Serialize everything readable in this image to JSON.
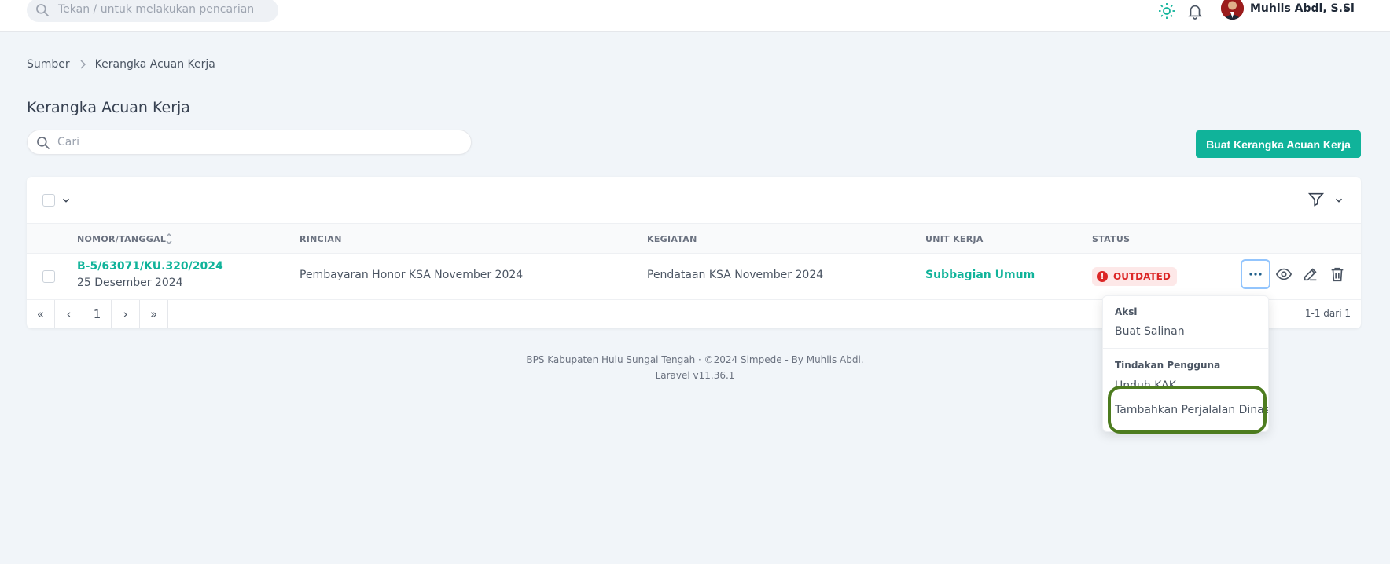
{
  "topbar": {
    "search_placeholder": "Tekan / untuk melakukan pencarian",
    "user_name": "Muhlis Abdi, S.Si"
  },
  "breadcrumb": [
    "Sumber",
    "Kerangka Acuan Kerja"
  ],
  "page": {
    "title": "Kerangka Acuan Kerja",
    "search_placeholder": "Cari",
    "create_button": "Buat Kerangka Acuan Kerja"
  },
  "table": {
    "columns": [
      "NOMOR/TANGGAL",
      "RINCIAN",
      "KEGIATAN",
      "UNIT KERJA",
      "STATUS"
    ],
    "rows": [
      {
        "nomor": "B-5/63071/KU.320/2024",
        "tanggal": "25 Desember 2024",
        "rincian": "Pembayaran Honor KSA November 2024",
        "kegiatan": "Pendataan KSA November 2024",
        "unit_kerja": "Subbagian Umum",
        "status": "OUTDATED"
      }
    ]
  },
  "pagination": {
    "first": "«",
    "prev": "‹",
    "page": "1",
    "next": "›",
    "last": "»",
    "summary": "1-1 dari 1"
  },
  "footer": {
    "line1": "BPS Kabupaten Hulu Sungai Tengah  ·  ©2024 Simpede - By Muhlis Abdi.",
    "line2": "Laravel v11.36.1"
  },
  "dropdown": {
    "section1_header": "Aksi",
    "section1_items": [
      "Buat Salinan"
    ],
    "section2_header": "Tindakan Pengguna",
    "section2_items": [
      "Unduh KAK",
      "Tambahkan Perjalalan Dinas"
    ]
  },
  "colors": {
    "accent": "#10b39a",
    "status_outdated": "#dc2626",
    "highlight": "#4d7c1f"
  }
}
